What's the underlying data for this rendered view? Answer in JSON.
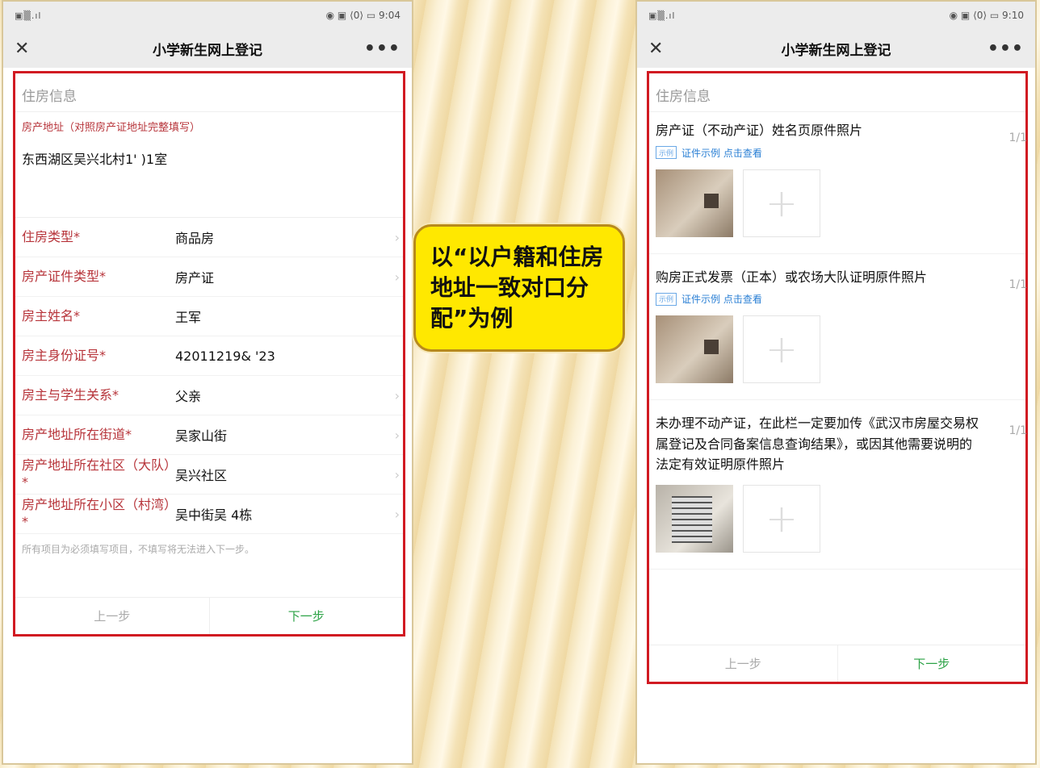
{
  "left": {
    "status": {
      "signal": "▣▒.ıl",
      "icons": "◉ ▣ ⟨0⟩ ▭",
      "time": "9:04"
    },
    "nav": {
      "title": "小学新生网上登记",
      "close": "✕",
      "more": "•••"
    },
    "section_title": "住房信息",
    "address_label": "房产地址（对照房产证地址完整填写）",
    "address_value": "东西湖区吴兴北村1'                    )1室",
    "rows": [
      {
        "label": "住房类型*",
        "value": "商品房"
      },
      {
        "label": "房产证件类型*",
        "value": "房产证"
      },
      {
        "label": "房主姓名*",
        "value": "王军"
      },
      {
        "label": "房主身份证号*",
        "value": "42011219&               '23"
      },
      {
        "label": "房主与学生关系*",
        "value": "父亲"
      },
      {
        "label": "房产地址所在街道*",
        "value": "吴家山街"
      },
      {
        "label": "房产地址所在社区（大队）*",
        "value": "吴兴社区"
      },
      {
        "label": "房产地址所在小区（村湾）*",
        "value": "吴中街吴                      4栋"
      }
    ],
    "note": "所有项目为必须填写项目，不填写将无法进入下一步。",
    "prev": "上一步",
    "next": "下一步"
  },
  "callout": {
    "text": "以“以户籍和住房地址一致对口分配”为例"
  },
  "right": {
    "status": {
      "signal": "▣▒.ıl",
      "icons": "◉ ▣ ⟨0⟩ ▭",
      "time": "9:10"
    },
    "nav": {
      "title": "小学新生网上登记",
      "close": "✕",
      "more": "•••"
    },
    "section_title": "住房信息",
    "uploads": [
      {
        "title": "房产证（不动产证）姓名页原件照片",
        "count": "1/1",
        "sample_label": "证件示例 点击查看",
        "sample_icon": "示例"
      },
      {
        "title": "购房正式发票（正本）或农场大队证明原件照片",
        "count": "1/1",
        "sample_label": "证件示例 点击查看",
        "sample_icon": "示例"
      },
      {
        "title": "未办理不动产证，在此栏一定要加传《武汉市房屋交易权属登记及合同备案信息查询结果》，或因其他需要说明的法定有效证明原件照片",
        "count": "1/1"
      }
    ],
    "add_symbol": "+",
    "prev": "上一步",
    "next": "下一步"
  }
}
